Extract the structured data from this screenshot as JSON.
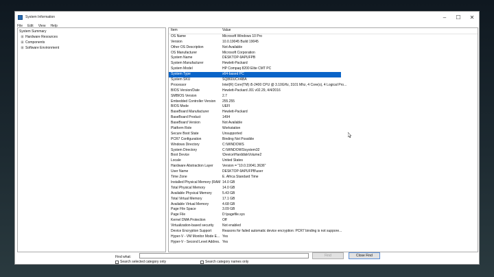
{
  "window": {
    "title": "System Information",
    "controls": {
      "minimize": "–",
      "maximize": "☐",
      "close": "✕"
    }
  },
  "menu": [
    "File",
    "Edit",
    "View",
    "Help"
  ],
  "tree": {
    "root": "System Summary",
    "children": [
      {
        "label": "Hardware Resources",
        "expander": "⊞"
      },
      {
        "label": "Components",
        "expander": "⊞"
      },
      {
        "label": "Software Environment",
        "expander": "⊞"
      }
    ]
  },
  "table": {
    "headers": {
      "item": "Item",
      "value": "Value"
    },
    "selected_index": 9,
    "rows": [
      {
        "item": "OS Name",
        "value": "Microsoft Windows 10 Pro"
      },
      {
        "item": "Version",
        "value": "10.0.19045 Build 19045"
      },
      {
        "item": "Other OS Description",
        "value": "Not Available"
      },
      {
        "item": "OS Manufacturer",
        "value": "Microsoft Corporation"
      },
      {
        "item": "System Name",
        "value": "DESKTOP-9APUFPB"
      },
      {
        "item": "System Manufacturer",
        "value": "Hewlett-Packard"
      },
      {
        "item": "System Model",
        "value": "HP Compaq 8200 Elite CMT PC"
      },
      {
        "item": "System Type",
        "value": "x64-based PC"
      },
      {
        "item": "System SKU",
        "value": "SQ860UC#ABA"
      },
      {
        "item": "Processor",
        "value": "Intel(R) Core(TM) i5-2400 CPU @ 3.10GHz, 3101 Mhz, 4 Core(s), 4 Logical Pro..."
      },
      {
        "item": "BIOS Version/Date",
        "value": "Hewlett-Packard J01 v02.29, 4/4/2016"
      },
      {
        "item": "SMBIOS Version",
        "value": "2.7"
      },
      {
        "item": "Embedded Controller Version",
        "value": "255.255"
      },
      {
        "item": "BIOS Mode",
        "value": "UEFI"
      },
      {
        "item": "BaseBoard Manufacturer",
        "value": "Hewlett-Packard"
      },
      {
        "item": "BaseBoard Product",
        "value": "1494"
      },
      {
        "item": "BaseBoard Version",
        "value": "Not Available"
      },
      {
        "item": "Platform Role",
        "value": "Workstation"
      },
      {
        "item": "Secure Boot State",
        "value": "Unsupported"
      },
      {
        "item": "PCR7 Configuration",
        "value": "Binding Not Possible"
      },
      {
        "item": "Windows Directory",
        "value": "C:\\WINDOWS"
      },
      {
        "item": "System Directory",
        "value": "C:\\WINDOWS\\system32"
      },
      {
        "item": "Boot Device",
        "value": "\\Device\\HarddiskVolume2"
      },
      {
        "item": "Locale",
        "value": "United States"
      },
      {
        "item": "Hardware Abstraction Layer",
        "value": "Version = \"10.0.19041.3636\""
      },
      {
        "item": "User Name",
        "value": "DESKTOP-9APUFPB\\user"
      },
      {
        "item": "Time Zone",
        "value": "E. Africa Standard Time"
      },
      {
        "item": "Installed Physical Memory (RAM)",
        "value": "14.0 GB"
      },
      {
        "item": "Total Physical Memory",
        "value": "14.0 GB"
      },
      {
        "item": "Available Physical Memory",
        "value": "5.43 GB"
      },
      {
        "item": "Total Virtual Memory",
        "value": "17.1 GB"
      },
      {
        "item": "Available Virtual Memory",
        "value": "4.68 GB"
      },
      {
        "item": "Page File Space",
        "value": "3.09 GB"
      },
      {
        "item": "Page File",
        "value": "D:\\pagefile.sys"
      },
      {
        "item": "Kernel DMA Protection",
        "value": "Off"
      },
      {
        "item": "Virtualization-based security",
        "value": "Not enabled"
      },
      {
        "item": "Device Encryption Support",
        "value": "Reasons for failed automatic device encryption: PCR7 binding is not suppore..."
      },
      {
        "item": "Hyper-V - VM Monitor Mode E...",
        "value": "Yes"
      },
      {
        "item": "Hyper-V - Second Level Addres...",
        "value": "Yes"
      }
    ]
  },
  "find": {
    "label": "Find what:",
    "value": "",
    "find_button": "Find",
    "close_button": "Close Find",
    "search_selected_label": "Search selected category only",
    "search_names_label": "Search category names only"
  }
}
